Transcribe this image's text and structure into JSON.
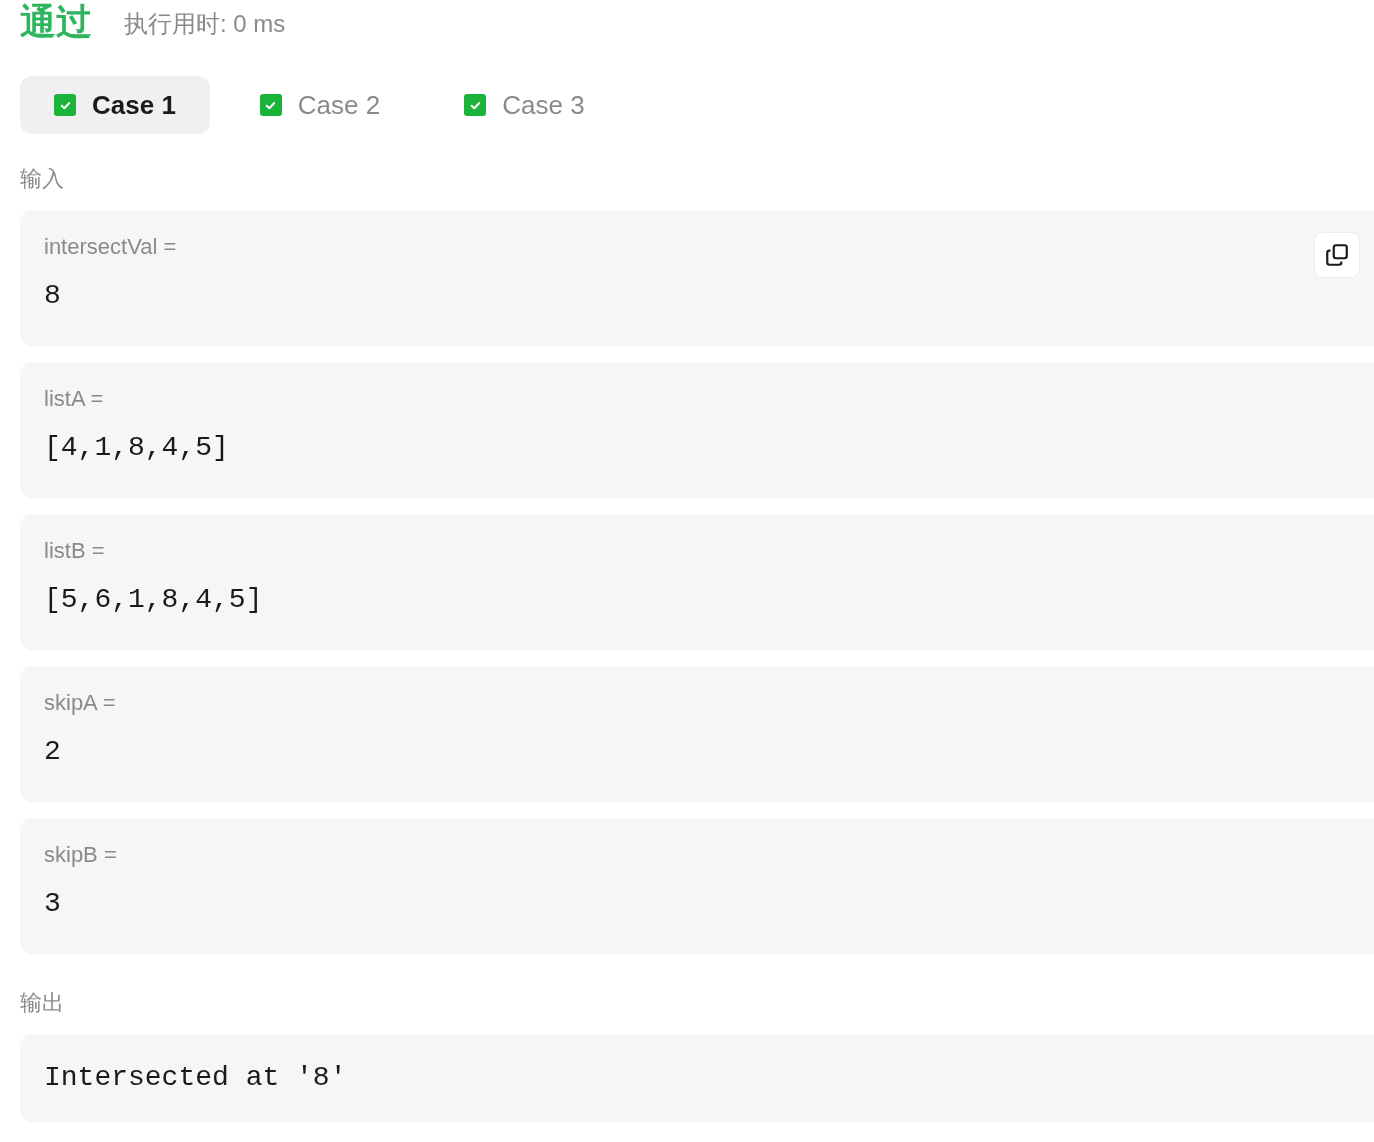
{
  "result": {
    "status": "通过",
    "runtime": "执行用时: 0 ms"
  },
  "tabs": [
    {
      "label": "Case 1",
      "selected": true,
      "checked": true
    },
    {
      "label": "Case 2",
      "selected": false,
      "checked": true
    },
    {
      "label": "Case 3",
      "selected": false,
      "checked": true
    }
  ],
  "input": {
    "heading": "输入",
    "params": [
      {
        "name": "intersectVal =",
        "value": "8"
      },
      {
        "name": "listA =",
        "value": "[4,1,8,4,5]"
      },
      {
        "name": "listB =",
        "value": "[5,6,1,8,4,5]"
      },
      {
        "name": "skipA =",
        "value": "2"
      },
      {
        "name": "skipB =",
        "value": "3"
      }
    ]
  },
  "output": {
    "heading": "输出",
    "value": "Intersected at '8'"
  }
}
